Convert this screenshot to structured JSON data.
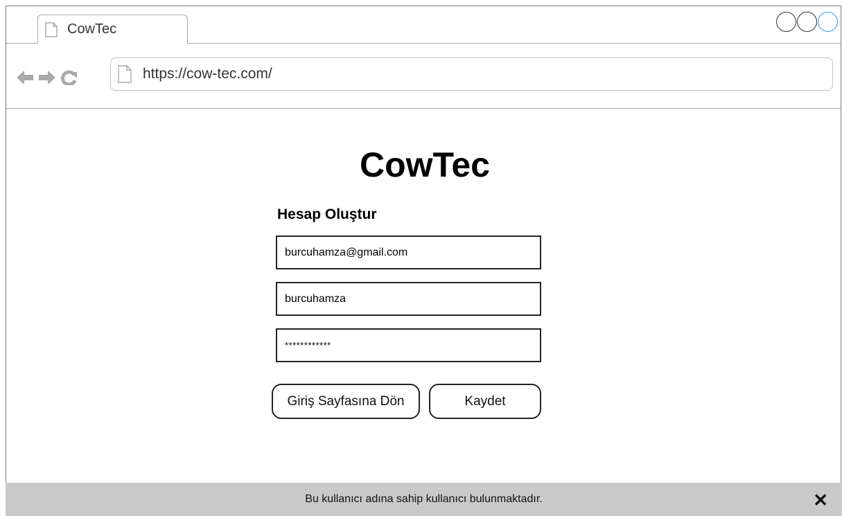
{
  "browser": {
    "tab_title": "CowTec",
    "url": "https://cow-tec.com/",
    "icons": [
      "back-arrow-icon",
      "forward-arrow-icon",
      "reload-icon",
      "document-icon"
    ],
    "window_controls": [
      "minimize-circle",
      "maximize-circle",
      "close-circle"
    ],
    "accent_color": "#2d9bf0"
  },
  "page": {
    "brand": "CowTec",
    "form_title": "Hesap Oluştur",
    "fields": {
      "email": "burcuhamza@gmail.com",
      "username": "burcuhamza",
      "password": "************"
    },
    "buttons": {
      "back": "Giriş Sayfasına Dön",
      "save": "Kaydet"
    }
  },
  "notification": {
    "message": "Bu kullanıcı adına sahip kullanıcı bulunmaktadır.",
    "close_symbol": "✕",
    "background_color": "#c9c9c9"
  }
}
